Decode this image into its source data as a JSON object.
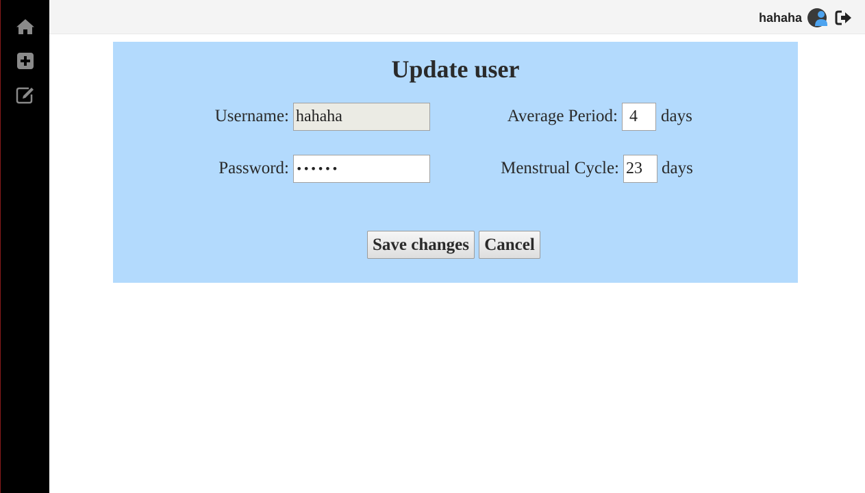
{
  "topbar": {
    "username": "hahaha"
  },
  "sidebar": {
    "items": [
      {
        "icon": "home-icon"
      },
      {
        "icon": "plus-square-icon"
      },
      {
        "icon": "edit-icon"
      }
    ]
  },
  "form": {
    "title": "Update user",
    "username_label": "Username:",
    "username_value": "hahaha",
    "password_label": "Password:",
    "password_value": "••••••",
    "average_period_label": "Average Period:",
    "average_period_value": "4",
    "average_period_unit": "days",
    "menstrual_cycle_label": "Menstrual Cycle:",
    "menstrual_cycle_value": "23",
    "menstrual_cycle_unit": "days",
    "save_label": "Save changes",
    "cancel_label": "Cancel"
  },
  "colors": {
    "sidebar_bg": "#000000",
    "topbar_bg": "#f4f4f4",
    "panel_bg": "#b3dafd",
    "avatar_accent": "#4da3ef",
    "icon_gray": "#8a8a8a"
  }
}
